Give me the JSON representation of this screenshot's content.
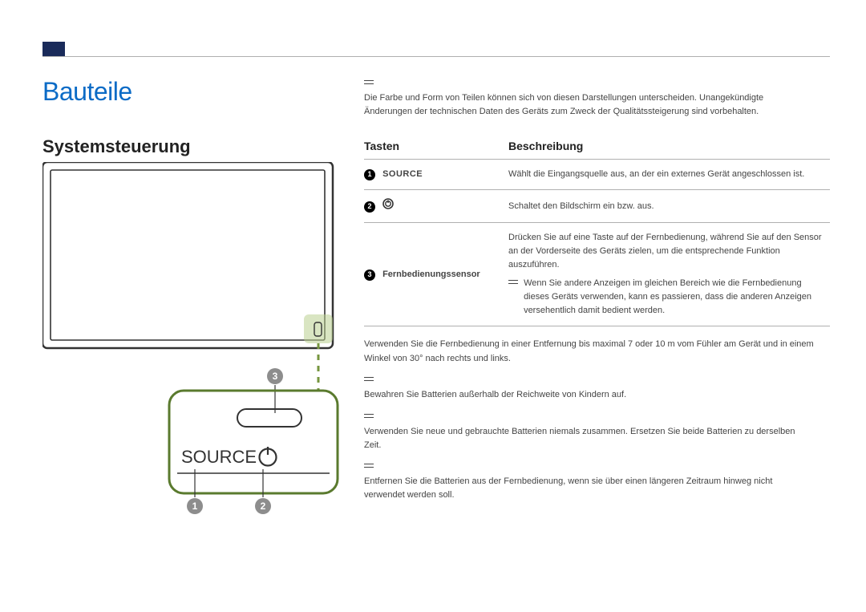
{
  "page": {
    "title": "Bauteile",
    "section": "Systemsteuerung"
  },
  "disclaimer": "Die Farbe und Form von Teilen können sich von diesen Darstellungen unterscheiden. Unangekündigte Änderungen der technischen Daten des Geräts zum Zweck der Qualitätssteigerung sind vorbehalten.",
  "table": {
    "head": {
      "col1": "Tasten",
      "col2": "Beschreibung"
    },
    "rows": [
      {
        "num": "1",
        "key_label": "SOURCE",
        "desc": "Wählt die Eingangsquelle aus, an der ein externes Gerät angeschlossen ist."
      },
      {
        "num": "2",
        "icon": "power",
        "desc": "Schaltet den Bildschirm ein bzw. aus."
      },
      {
        "num": "3",
        "key_label": "Fernbedienungssensor",
        "desc": "Drücken Sie auf eine Taste auf der Fernbedienung, während Sie auf den Sensor an der Vorderseite des Geräts zielen, um die entsprechende Funktion auszuführen.",
        "note": "Wenn Sie andere Anzeigen im gleichen Bereich wie die Fernbedienung dieses Geräts verwenden, kann es passieren, dass die anderen Anzeigen versehentlich damit bedient werden."
      }
    ]
  },
  "remote_note": "Verwenden Sie die Fernbedienung in einer Entfernung bis maximal 7 oder 10 m vom Fühler am Gerät und in einem Winkel von 30° nach rechts und links.",
  "bullets": [
    "Bewahren Sie Batterien außerhalb der Reichweite von Kindern auf.",
    "Verwenden Sie neue und gebrauchte Batterien niemals zusammen. Ersetzen Sie beide Batterien zu derselben Zeit.",
    "Entfernen Sie die Batterien aus der Fernbedienung, wenn sie über einen längeren Zeitraum hinweg nicht verwendet werden soll."
  ],
  "diagram": {
    "source_label": "SOURCE",
    "callouts": {
      "c1": "1",
      "c2": "2",
      "c3": "3"
    }
  }
}
